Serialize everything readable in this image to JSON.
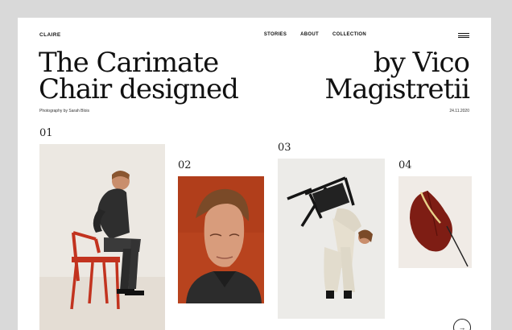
{
  "nav": {
    "brand": "CLAIRE",
    "links": [
      "STORIES",
      "ABOUT",
      "COLLECTION"
    ],
    "menu_icon": "hamburger-icon"
  },
  "hero": {
    "title_left": [
      "The Carimate",
      "Chair designed"
    ],
    "title_right": [
      "by Vico",
      "Magistretii"
    ],
    "photo_credit": "Photography by Sarah Blois",
    "date": "24.11.2020"
  },
  "gallery": [
    {
      "number": "01"
    },
    {
      "number": "02"
    },
    {
      "number": "03"
    },
    {
      "number": "04"
    }
  ],
  "next_icon": "arrow-right-icon",
  "next_glyph": "→",
  "colors": {
    "accent_red": "#b8431e",
    "chair_red": "#c2331f",
    "text": "#111111",
    "background": "#ffffff"
  }
}
